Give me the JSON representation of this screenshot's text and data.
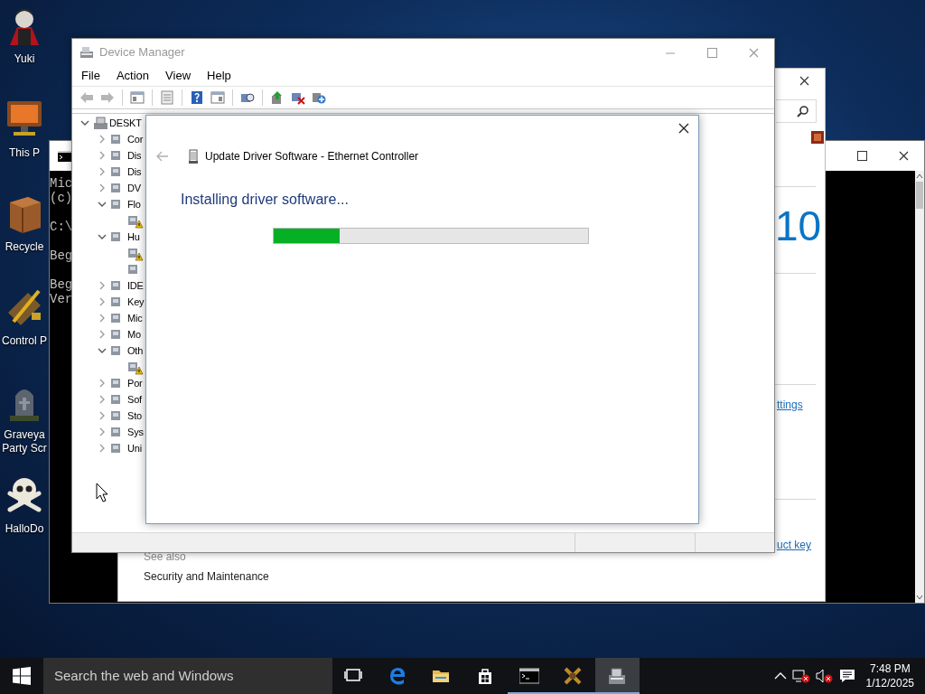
{
  "desktop_icons": [
    {
      "kind": "figure",
      "label": "Yuki"
    },
    {
      "kind": "computer",
      "label": "This P"
    },
    {
      "kind": "crate",
      "label": "Recycle"
    },
    {
      "kind": "tools",
      "label": "Control P"
    },
    {
      "kind": "grave",
      "label": "Graveya Party Scr"
    },
    {
      "kind": "skull",
      "label": "HalloDo"
    }
  ],
  "console_window": {
    "paragraphs": [
      [
        "Mic",
        "(c)"
      ],
      [
        "C:\\"
      ],
      [
        "Beg"
      ],
      [
        "Beg",
        "Ver"
      ]
    ]
  },
  "system_window": {
    "heading": "10",
    "links": [
      {
        "text": "ttings"
      },
      {
        "text": "uct key"
      }
    ],
    "see_also": {
      "heading": "See also",
      "links": [
        "Security and Maintenance"
      ]
    }
  },
  "device_manager": {
    "title": "Device Manager",
    "menu": [
      "File",
      "Action",
      "View",
      "Help"
    ],
    "tree": {
      "label": "DESKT",
      "expanded": true,
      "children": [
        {
          "label": "Cor",
          "expanded": false
        },
        {
          "label": "Dis",
          "expanded": false
        },
        {
          "label": "Dis",
          "expanded": false
        },
        {
          "label": "DV",
          "expanded": false
        },
        {
          "label": "Flo",
          "expanded": true,
          "children": [
            {
              "warning": true
            }
          ]
        },
        {
          "label": "Hu",
          "expanded": true,
          "children": [
            {
              "warning": true
            },
            {
              "warning": false
            }
          ]
        },
        {
          "label": "IDE",
          "expanded": false
        },
        {
          "label": "Key",
          "expanded": false
        },
        {
          "label": "Mic",
          "expanded": false
        },
        {
          "label": "Mo",
          "expanded": false
        },
        {
          "label": "Oth",
          "expanded": true,
          "children": [
            {
              "warning": true
            }
          ]
        },
        {
          "label": "Por",
          "expanded": false
        },
        {
          "label": "Sof",
          "expanded": false
        },
        {
          "label": "Sto",
          "expanded": false
        },
        {
          "label": "Sys",
          "expanded": false
        },
        {
          "label": "Uni",
          "expanded": false
        }
      ]
    }
  },
  "dialog": {
    "title": "Update Driver Software - Ethernet Controller",
    "heading": "Installing driver software...",
    "back_disabled": true,
    "progress": {
      "level": 0.21
    }
  },
  "taskbar": {
    "search": {
      "placeholder": "Search the web and Windows"
    },
    "apps": [
      {
        "kind": "taskview",
        "running": false,
        "selected": false
      },
      {
        "kind": "browser",
        "running": false,
        "selected": false
      },
      {
        "kind": "folder",
        "running": false,
        "selected": false
      },
      {
        "kind": "store",
        "running": false,
        "selected": false
      },
      {
        "kind": "console",
        "running": true,
        "selected": false
      },
      {
        "kind": "game",
        "running": true,
        "selected": false
      },
      {
        "kind": "devices",
        "running": true,
        "selected": true
      }
    ],
    "clock": {
      "time": "7:48 PM",
      "date": "1/12/2025"
    }
  }
}
